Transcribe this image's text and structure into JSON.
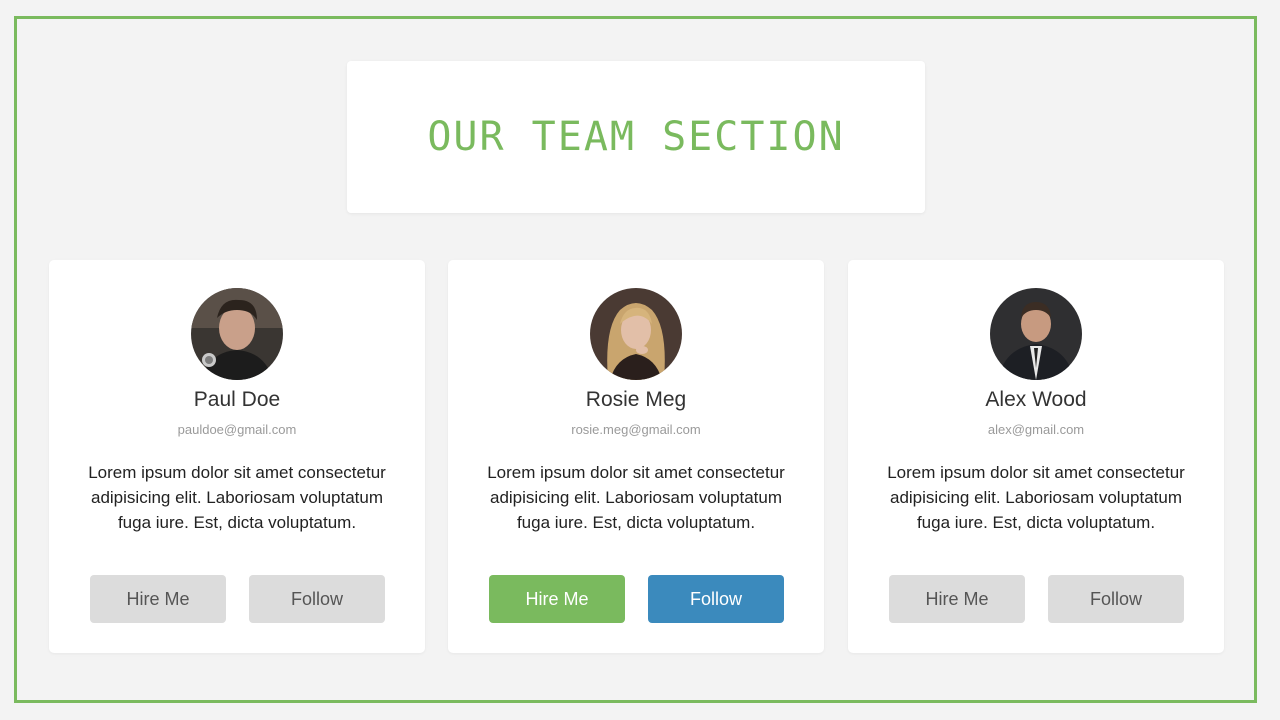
{
  "section": {
    "title": "OUR TEAM SECTION"
  },
  "colors": {
    "accent_green": "#7aba5e",
    "accent_blue": "#3b8abd",
    "button_gray": "#dcdcdc",
    "background": "#f3f3f3"
  },
  "members": [
    {
      "name": "Paul Doe",
      "email": "pauldoe@gmail.com",
      "description": "Lorem ipsum dolor sit amet consectetur adipisicing elit. Laboriosam voluptatum fuga iure. Est, dicta voluptatum.",
      "hire_label": "Hire Me",
      "follow_label": "Follow"
    },
    {
      "name": "Rosie Meg",
      "email": "rosie.meg@gmail.com",
      "description": "Lorem ipsum dolor sit amet consectetur adipisicing elit. Laboriosam voluptatum fuga iure. Est, dicta voluptatum.",
      "hire_label": "Hire Me",
      "follow_label": "Follow"
    },
    {
      "name": "Alex Wood",
      "email": "alex@gmail.com",
      "description": "Lorem ipsum dolor sit amet consectetur adipisicing elit. Laboriosam voluptatum fuga iure. Est, dicta voluptatum.",
      "hire_label": "Hire Me",
      "follow_label": "Follow"
    }
  ]
}
